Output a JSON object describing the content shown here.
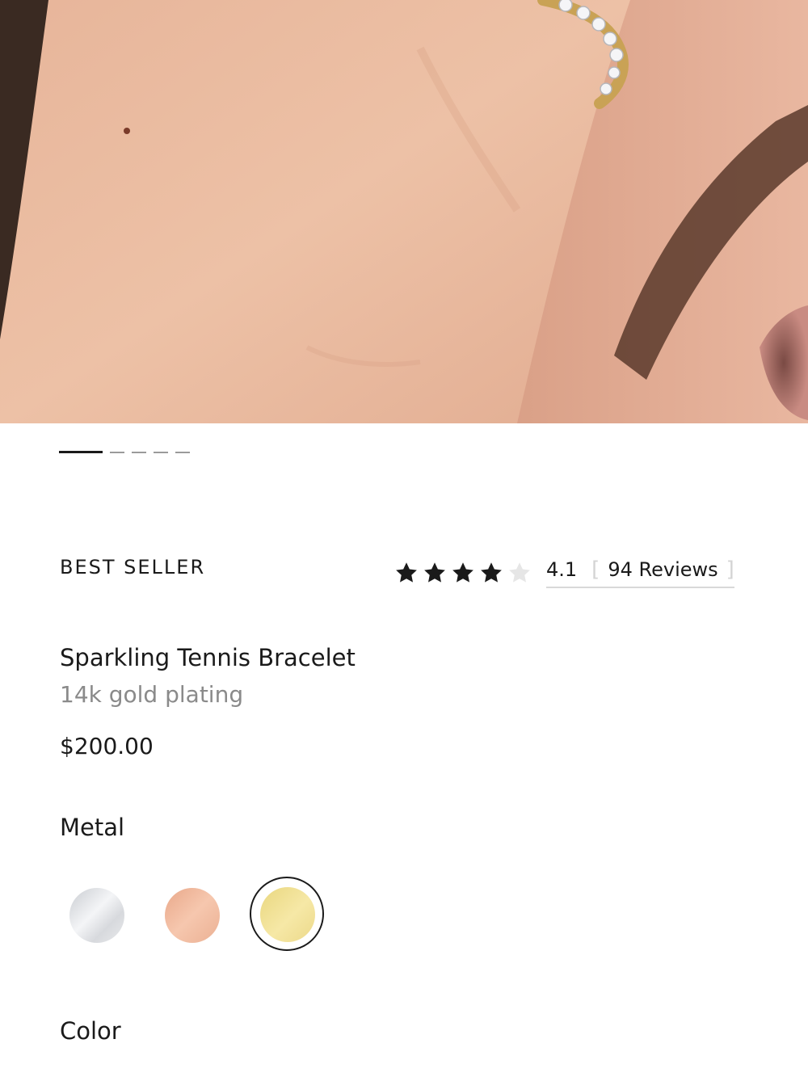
{
  "hero": {
    "image": "product photo: tennis bracelet worn on wrist near face",
    "carousel": {
      "total": 5,
      "active_index": 0
    }
  },
  "badge": "BEST SELLER",
  "rating": {
    "value": "4.1",
    "stars_filled": 4,
    "stars_total": 5,
    "reviews_label": "94 Reviews",
    "bracket_open": "[",
    "bracket_close": "]"
  },
  "product": {
    "title": "Sparkling Tennis Bracelet",
    "subtitle": "14k gold plating",
    "price": "$200.00"
  },
  "options": {
    "metal_label": "Metal",
    "metal_swatches": [
      {
        "name": "silver",
        "color": "#e6e7ea",
        "selected": false
      },
      {
        "name": "rose gold",
        "color": "#f1b89c",
        "selected": false
      },
      {
        "name": "gold",
        "color": "#f0e08f",
        "selected": true
      }
    ],
    "color_label": "Color"
  },
  "icons": {
    "star_filled": "star-icon",
    "star_empty": "star-outline-icon"
  },
  "colors": {
    "text": "#1a1a1a",
    "muted": "#8a8a8a",
    "star": "#1a1a1a",
    "star_empty": "#e6e6e6"
  }
}
